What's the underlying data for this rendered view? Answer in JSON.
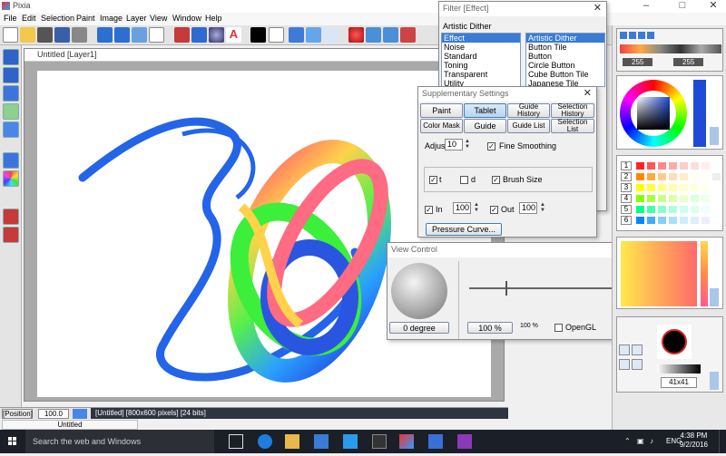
{
  "app": {
    "title": "Pixia",
    "menu": [
      "File",
      "Edit",
      "Selection",
      "Paint",
      "Image",
      "Layer",
      "View",
      "Window",
      "Help"
    ]
  },
  "canvas_window": {
    "title": "Untitled [Layer1]"
  },
  "status": {
    "position_label": "[Position]",
    "zoom_value": "100.0",
    "info": "[Untitled] [800x600 pixels] [24 bits]",
    "tab_label": "Untitled"
  },
  "filter_dialog": {
    "title": "Filter [Effect]",
    "category": "Artistic Dither",
    "left_list": [
      "Effect",
      "Noise",
      "Standard",
      "Toning",
      "Transparent",
      "Utility"
    ],
    "right_list": [
      "Artistic Dither",
      "Button Tile",
      "Button",
      "Circle Button",
      "Cube Button Tile",
      "Japanese Tile"
    ]
  },
  "supplementary": {
    "title": "Supplementary Settings",
    "tabs_row1": [
      "Paint",
      "Tablet",
      "Guide History",
      "Selection History"
    ],
    "tabs_row2": [
      "Color Mask",
      "Guide",
      "Guide List",
      "Selection List"
    ],
    "adjust_label": "Adjus",
    "adjust_value": "10",
    "fine_smoothing": "Fine Smoothing",
    "opt_t": "t",
    "opt_d": "d",
    "brush_size": "Brush Size",
    "in_label": "In",
    "in_value": "100",
    "out_label": "Out",
    "out_value": "100",
    "pressure_button": "Pressure Curve..."
  },
  "view_control": {
    "title": "View Control",
    "degree": "0 degree",
    "zoom_value": "100 %",
    "zoom_label": "100 %",
    "opengl": "OpenGL"
  },
  "right_panel": {
    "opacity_a": "255",
    "opacity_b": "255",
    "palette_rows": [
      "1",
      "2",
      "3",
      "4",
      "5",
      "6"
    ],
    "brush_size": "41x41"
  },
  "taskbar": {
    "search_placeholder": "Search the web and Windows",
    "lang": "ENG",
    "time": "4:38 PM",
    "date": "9/2/2016"
  },
  "colors": {
    "accent": "#3a7bd5",
    "taskbar": "#1b1f27",
    "status_info_bg": "#2e3440"
  }
}
